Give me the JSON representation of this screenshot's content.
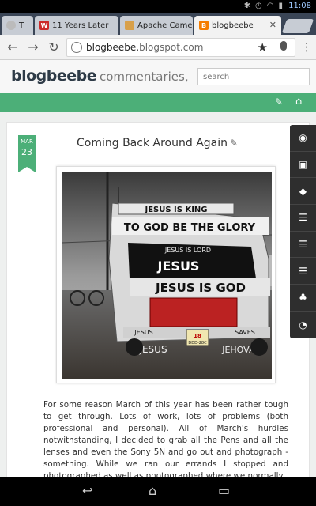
{
  "status": {
    "time": "11:08"
  },
  "tabs": [
    {
      "label": "T",
      "fav": ""
    },
    {
      "label": "11 Years Later",
      "fav": "W"
    },
    {
      "label": "Apache Came",
      "fav": ""
    },
    {
      "label": "blogbeebe",
      "fav": "B"
    }
  ],
  "omnibox": {
    "url_prefix": "blogbeebe.",
    "url_domain": "blogspot.com"
  },
  "blog": {
    "title": "blogbeebe",
    "description": "commentaries, ca.",
    "search_placeholder": "search"
  },
  "post": {
    "month": "MAR",
    "day": "23",
    "title": "Coming Back Around Again",
    "body": "For some reason March of this year has been rather tough to get through. Lots of work, lots of problems (both professional and personal). All of March's hurdles notwithstanding, I decided to grab all the Pens and all the lenses and even the Sony 5N and go out and photograph - something. While we ran our errands I stopped and photographed as well as photographed where we normally"
  },
  "photo": {
    "sign_top": "JESUS IS KING",
    "banner": "TO GOD BE THE GLORY",
    "windshield_top": "JESUS IS LORD",
    "windshield": "JESUS",
    "hood": "JESUS IS GOD",
    "bumper_left": "JESUS",
    "bumper_right": "SAVES",
    "plate": "18",
    "plate_tag": "DDD-28C",
    "bottom_left": "JESUS",
    "bottom_right": "JEHOVAH"
  },
  "icons": {
    "sidebar": [
      "profile-icon",
      "blogger-icon",
      "tag-icon",
      "list-icon",
      "list-icon",
      "list-icon",
      "followers-icon",
      "rss-icon"
    ]
  }
}
